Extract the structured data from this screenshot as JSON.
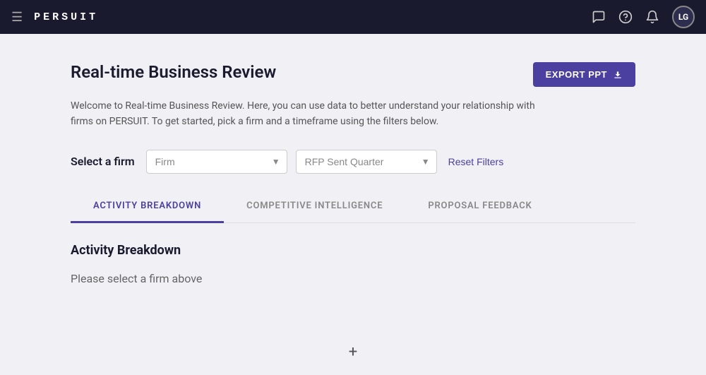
{
  "nav": {
    "logo": "PERSUIT",
    "icons": {
      "menu": "☰",
      "chat": "💬",
      "help": "?",
      "bell": "🔔"
    },
    "avatar_label": "LG"
  },
  "page": {
    "title": "Real-time Business Review",
    "description": "Welcome to Real-time Business Review. Here, you can use data to better understand your relationship with firms on PERSUIT. To get started, pick a firm and a timeframe using the filters below.",
    "export_button_label": "EXPORT PPT",
    "filter_label": "Select a firm",
    "firm_placeholder": "Firm",
    "quarter_placeholder": "RFP Sent Quarter",
    "reset_filters_label": "Reset Filters"
  },
  "tabs": [
    {
      "id": "activity-breakdown",
      "label": "ACTIVITY BREAKDOWN",
      "active": true
    },
    {
      "id": "competitive-intelligence",
      "label": "COMPETITIVE INTELLIGENCE",
      "active": false
    },
    {
      "id": "proposal-feedback",
      "label": "PROPOSAL FEEDBACK",
      "active": false
    }
  ],
  "tab_content": {
    "activity_breakdown": {
      "title": "Activity Breakdown",
      "empty_message": "Please select a firm above"
    }
  },
  "bottom": {
    "plus_icon": "+"
  }
}
